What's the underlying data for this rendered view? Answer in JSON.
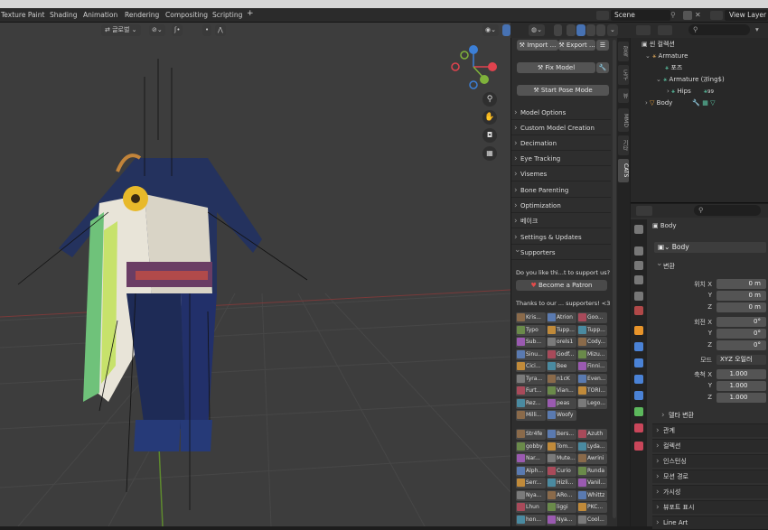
{
  "menubar": {
    "workspaces": [
      "Texture Paint",
      "Shading",
      "Animation",
      "Rendering",
      "Compositing",
      "Scripting"
    ],
    "add_tab": "+",
    "scene": "Scene",
    "view_layer": "View Layer"
  },
  "viewport": {
    "orientation": "글로벌",
    "transform_label": "ʃ•"
  },
  "cats": {
    "import": "Import ...",
    "export": "Export ...",
    "fix_model": "Fix Model",
    "start_pose": "Start Pose Mode",
    "sections": [
      "Model Options",
      "Custom Model Creation",
      "Decimation",
      "Eye Tracking",
      "Visemes",
      "Bone Parenting",
      "Optimization",
      "베이크",
      "Settings & Updates"
    ],
    "supporters_title": "Supporters",
    "support_question": "Do you like thi...t to support us?",
    "patron_button": "Become a Patron",
    "thanks": "Thanks to our ... supporters! <3",
    "supporters": [
      [
        "Kris...",
        "Atrion",
        "Goo..."
      ],
      [
        "Typo",
        "Tupp...",
        "Tupp..."
      ],
      [
        "Sub...",
        "orels1",
        "Cody..."
      ],
      [
        "Sinu...",
        "Godf...",
        "Mizu..."
      ],
      [
        "Cici...",
        "Bee",
        "Finni..."
      ],
      [
        "Tyra...",
        "n1cK",
        "Even..."
      ],
      [
        "Furt...",
        "Vian...",
        "TORI..."
      ],
      [
        "Rez...",
        "peas",
        "Lego..."
      ],
      [
        "Milli...",
        "Woofy",
        ""
      ]
    ],
    "supporters2": [
      [
        "Str4fe",
        "Bers...",
        "Azuth"
      ],
      [
        "gobby",
        "Tom...",
        "Lyda..."
      ],
      [
        "Nar...",
        "Mute...",
        "Awrini"
      ],
      [
        "Alph...",
        "Curio",
        "Runda"
      ],
      [
        "Serr...",
        "Hizli...",
        "Vanil..."
      ],
      [
        "Nya...",
        "ARo...",
        "Whittz"
      ],
      [
        "Lhun",
        "liggi",
        "PKC..."
      ],
      [
        "hon...",
        "Nya...",
        "Cool..."
      ]
    ],
    "tabs": [
      "항목",
      "도구",
      "뷰",
      "MMD",
      "기타",
      "CATS"
    ]
  },
  "outliner": {
    "collection": "씬 컬렉션",
    "armature": "Armature",
    "pose": "포즈",
    "armature_data": "Armature (ਗ਼ing$)",
    "hips": "Hips",
    "hips_count": "99",
    "body": "Body"
  },
  "properties": {
    "object_name": "Body",
    "object_field": "Body",
    "transform": "변환",
    "location_label": "위치 X",
    "rotation_label": "회전 X",
    "scale_label": "축척 X",
    "y_label": "Y",
    "z_label": "Z",
    "loc_x": "0 m",
    "loc_y": "0 m",
    "loc_z": "0 m",
    "rot_x": "0°",
    "rot_y": "0°",
    "rot_z": "0°",
    "mode_label": "모드",
    "mode_value": "XYZ 오일러",
    "scale_x": "1.000",
    "scale_y": "1.000",
    "scale_z": "1.000",
    "delta": "델타 변환",
    "sections": [
      "관계",
      "컬렉션",
      "인스턴싱",
      "모션 경로",
      "가시성",
      "뷰포트 표시",
      "Line Art"
    ]
  },
  "colors": {
    "accent": "#4772b3",
    "x_axis": "#e0434e",
    "y_axis": "#7fb23b",
    "z_axis": "#3c7fd6"
  }
}
